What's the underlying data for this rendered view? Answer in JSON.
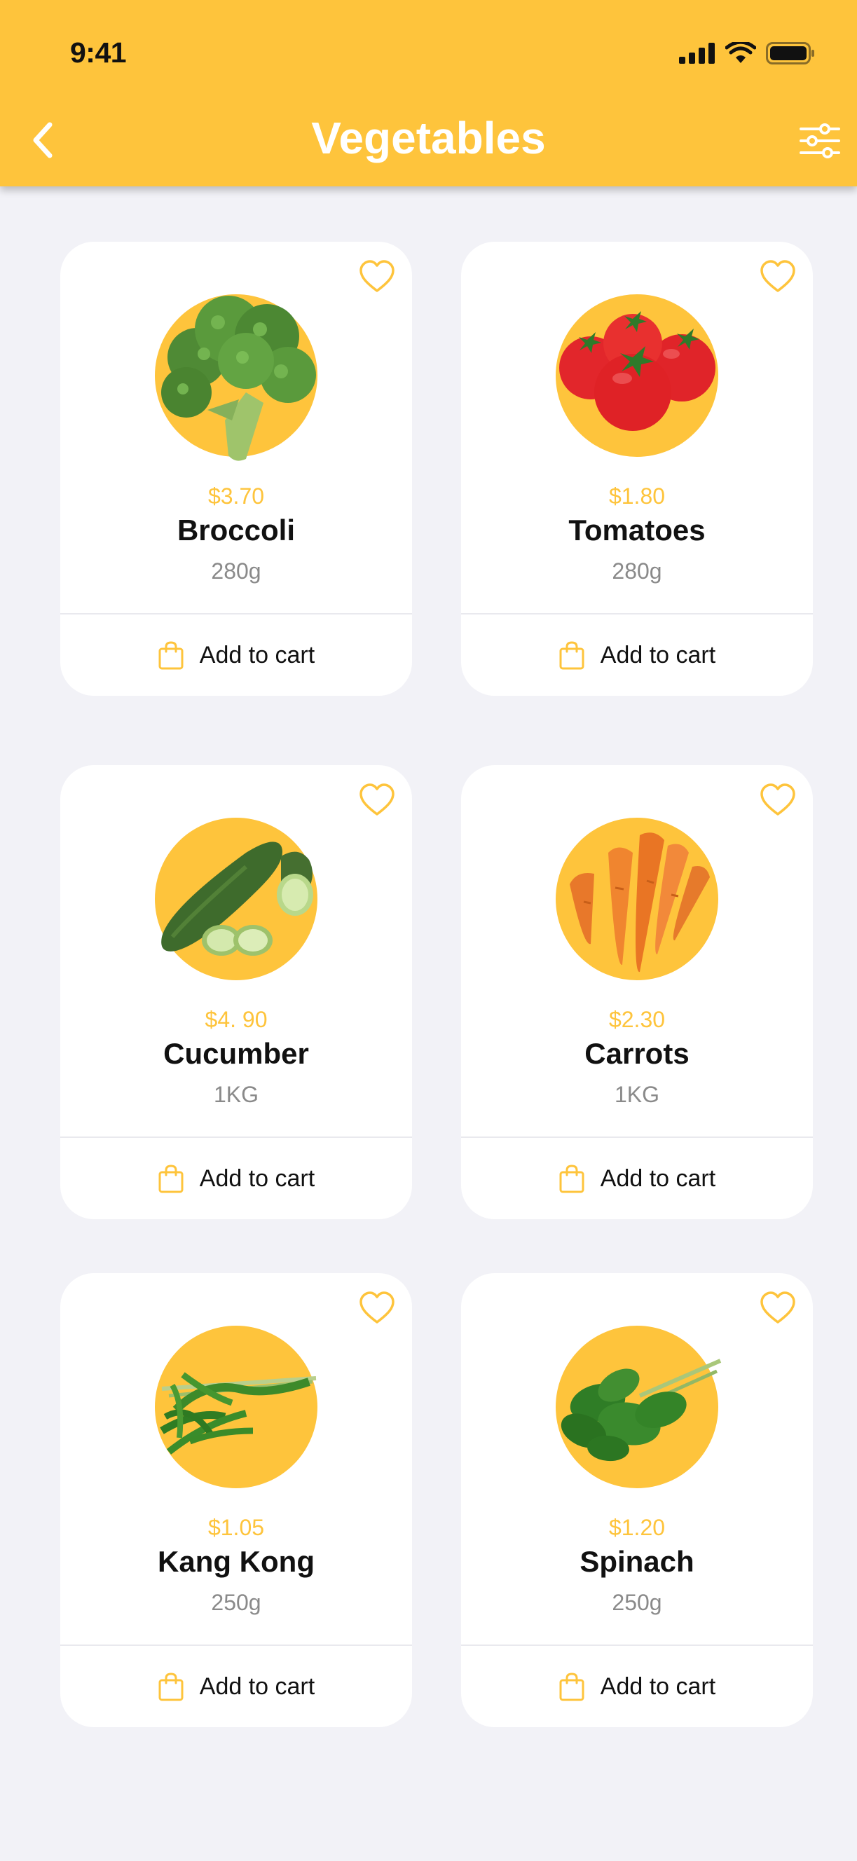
{
  "status_bar": {
    "time": "9:41"
  },
  "header": {
    "title": "Vegetables"
  },
  "colors": {
    "accent": "#fec43c",
    "background": "#f2f2f7",
    "card": "#ffffff",
    "muted": "#8a8a8a"
  },
  "products": [
    {
      "name": "Broccoli",
      "price": "$3.70",
      "weight": "280g",
      "cta": "Add to cart",
      "icon": "broccoli-icon"
    },
    {
      "name": "Tomatoes",
      "price": "$1.80",
      "weight": "280g",
      "cta": "Add to cart",
      "icon": "tomatoes-icon"
    },
    {
      "name": "Cucumber",
      "price": "$4. 90",
      "weight": "1KG",
      "cta": "Add to cart",
      "icon": "cucumber-icon"
    },
    {
      "name": "Carrots",
      "price": "$2.30",
      "weight": "1KG",
      "cta": "Add to cart",
      "icon": "carrots-icon"
    },
    {
      "name": "Kang Kong",
      "price": "$1.05",
      "weight": "250g",
      "cta": "Add to cart",
      "icon": "kang-kong-icon"
    },
    {
      "name": "Spinach",
      "price": "$1.20",
      "weight": "250g",
      "cta": "Add to cart",
      "icon": "spinach-icon"
    }
  ]
}
